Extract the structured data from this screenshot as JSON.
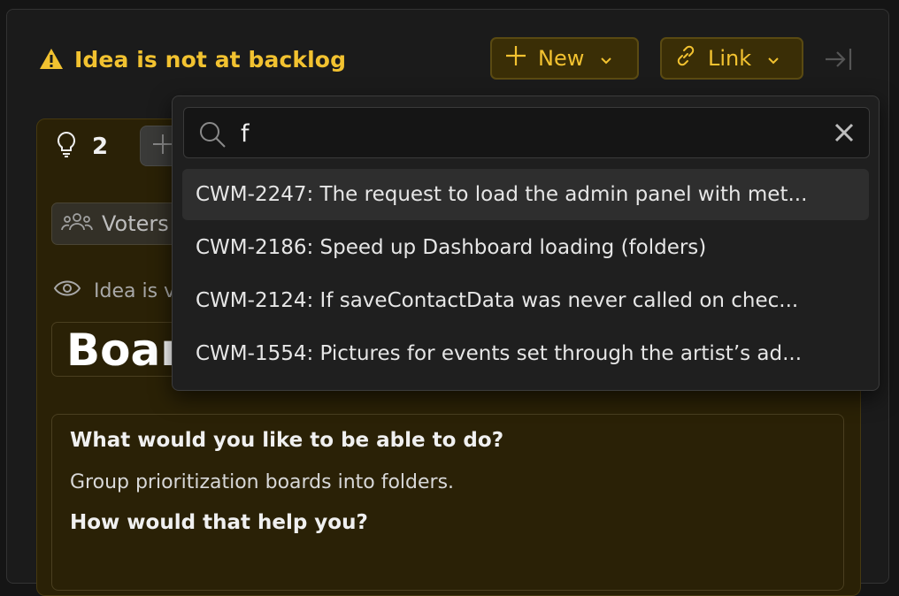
{
  "header": {
    "warning_text": "Idea is not at backlog",
    "new_label": "New",
    "link_label": "Link"
  },
  "idea": {
    "vote_count": "2",
    "voters_label": "Voters",
    "visibility_text": "Idea is v",
    "title_partial": "Board",
    "questions": [
      {
        "q": "What would you like to be able to do?",
        "a": "Group prioritization boards into folders."
      },
      {
        "q": "How would that help you?",
        "a": ""
      }
    ]
  },
  "search": {
    "value": "f",
    "placeholder": ""
  },
  "results": [
    {
      "text": "CWM-2247: The request to load the admin panel with met..."
    },
    {
      "text": "CWM-2186: Speed up Dashboard loading (folders)"
    },
    {
      "text": "CWM-2124: If saveContactData was never called on chec..."
    },
    {
      "text": "CWM-1554: Pictures for events set through the artist’s ad..."
    }
  ],
  "colors": {
    "accent": "#f2c230",
    "card_bg": "#2a2106",
    "dropdown_bg": "#1f1f1f",
    "active_row": "#2e2e2e"
  },
  "icons": [
    "warning-icon",
    "plus-icon",
    "chevron-down-icon",
    "link-icon",
    "collapse-right-icon",
    "lightbulb-icon",
    "users-icon",
    "eye-icon",
    "search-icon",
    "close-icon"
  ]
}
